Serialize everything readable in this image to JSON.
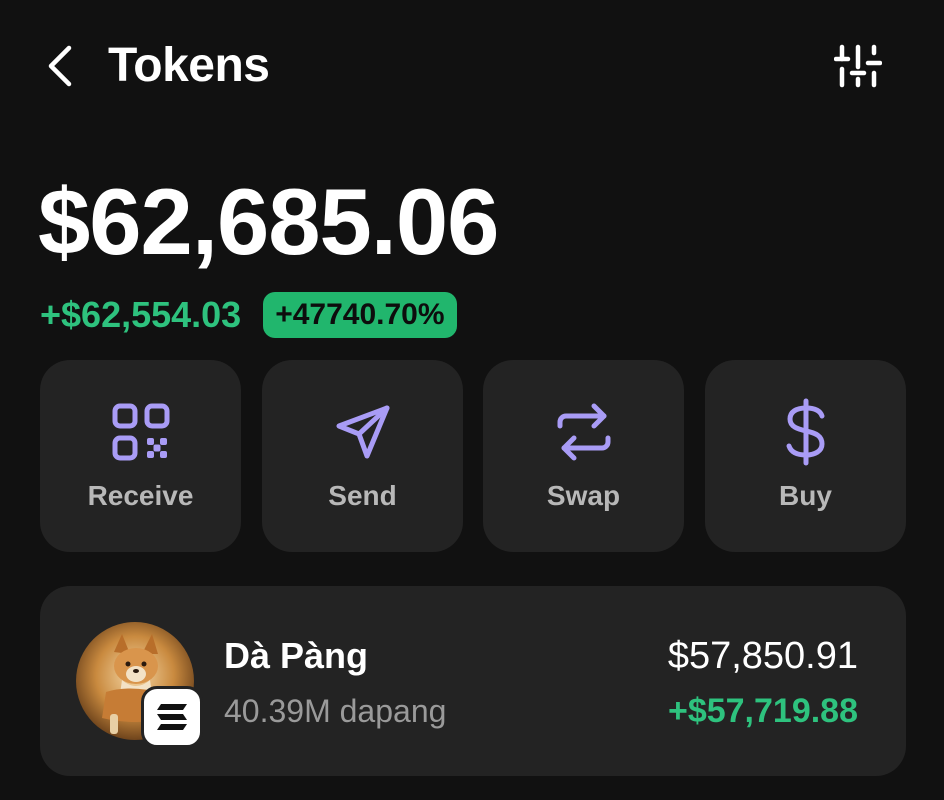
{
  "header": {
    "title": "Tokens",
    "back_icon": "chevron-left-icon",
    "filter_icon": "sliders-icon"
  },
  "portfolio": {
    "balance": "$62,685.06",
    "change_amount": "+$62,554.03",
    "change_percent": "+47740.70%"
  },
  "actions": [
    {
      "label": "Receive",
      "icon": "qr-code-icon"
    },
    {
      "label": "Send",
      "icon": "send-icon"
    },
    {
      "label": "Swap",
      "icon": "swap-icon"
    },
    {
      "label": "Buy",
      "icon": "dollar-icon"
    }
  ],
  "tokens": [
    {
      "name": "Dà Pàng",
      "amount": "40.39M dapang",
      "value": "$57,850.91",
      "change": "+$57,719.88",
      "avatar_icon": "dog-avatar",
      "chain_icon": "solana-icon"
    }
  ],
  "colors": {
    "background": "#111111",
    "card": "#232323",
    "accent_purple": "#a99cf6",
    "positive_green": "#2ec27e",
    "badge_green": "#21b66d",
    "muted_text": "#9a9a9a"
  }
}
